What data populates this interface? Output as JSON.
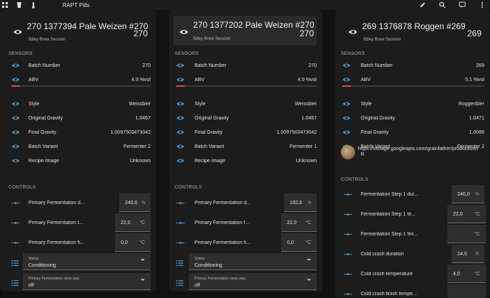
{
  "topbar": {
    "title": "RAPT Pills",
    "icons": [
      "dashboard-icon",
      "cup-icon",
      "thermometer-icon",
      "pencil-icon",
      "search-icon",
      "chat-icon",
      "more-vert-icon"
    ]
  },
  "colors": {
    "card": "#1c1c1c",
    "background": "#111111",
    "accent": "#4a8ec2",
    "abv_bar": "#d05050"
  },
  "cards": [
    {
      "title": "270 1377394 Pale Weizen #270",
      "subtitle": "fidley Brew Session",
      "number": "270",
      "sensors_label": "SENSORS",
      "sensors": [
        {
          "label": "Batch Number",
          "value": "270"
        },
        {
          "label": "ABV",
          "value": "4.9 %vol"
        },
        {
          "label": "Style",
          "value": "Weissbier"
        },
        {
          "label": "Original Gravity",
          "value": "1.0467"
        },
        {
          "label": "Final Gravity",
          "value": "1.0097503473042"
        },
        {
          "label": "Batch Variant",
          "value": "Fermenter 2"
        },
        {
          "label": "Recipe Image",
          "value": "Unknown"
        }
      ],
      "controls_label": "CONTROLS",
      "controls": [
        {
          "label": "Primary Fermentation d...",
          "value": "240,0",
          "unit": "h"
        },
        {
          "label": "Primary Fermentation t...",
          "value": "22,0",
          "unit": "°C"
        },
        {
          "label": "Primary Fermentation fi...",
          "value": "0,0",
          "unit": "°C"
        }
      ],
      "selects": [
        {
          "label": "Status",
          "value": "Conditioning"
        },
        {
          "label": "Primary Fermentation ramp step",
          "value": "off"
        }
      ]
    },
    {
      "title": "270 1377202 Pale Weizen #270",
      "subtitle": "fidley Brew Session",
      "number": "270",
      "sensors_label": "SENSORS",
      "sensors": [
        {
          "label": "Batch Number",
          "value": "270"
        },
        {
          "label": "ABV",
          "value": "4.9 %vol"
        },
        {
          "label": "Style",
          "value": "Weissbier"
        },
        {
          "label": "Original Gravity",
          "value": "1.0467"
        },
        {
          "label": "Final Gravity",
          "value": "1.0097503473042"
        },
        {
          "label": "Batch Variant",
          "value": "Fermenter 1"
        },
        {
          "label": "Recipe Image",
          "value": "Unknown"
        }
      ],
      "controls_label": "CONTROLS",
      "controls": [
        {
          "label": "Primary Fermentation d...",
          "value": "192,0",
          "unit": "h"
        },
        {
          "label": "Primary Fermentation t...",
          "value": "22,0",
          "unit": "°C"
        },
        {
          "label": "Primary Fermentation fi...",
          "value": "0,0",
          "unit": "°C"
        }
      ],
      "selects": [
        {
          "label": "Status",
          "value": "Conditioning"
        },
        {
          "label": "Primary Fermentation ramp step",
          "value": "off"
        }
      ]
    },
    {
      "title": "269 1376878 Roggen #269",
      "subtitle": "fidley Brew Session",
      "number": "269",
      "sensors_label": "SENSORS",
      "sensors": [
        {
          "label": "Batch Number",
          "value": "269"
        },
        {
          "label": "ABV",
          "value": "5.1 %vol"
        },
        {
          "label": "Style",
          "value": "Roggenbier"
        },
        {
          "label": "Original Gravity",
          "value": "1.0471"
        },
        {
          "label": "Final Gravity",
          "value": "1.0086"
        },
        {
          "label": "Batch Variant",
          "value": "Fermenter 2"
        }
      ],
      "image_url": "https://storage.googleapis.com/grainfather/production/r",
      "image_url_suffix": "R",
      "controls_label": "CONTROLS",
      "controls": [
        {
          "label": "Fermentation Step 1 dur...",
          "value": "240,0",
          "unit": "h"
        },
        {
          "label": "Fermentation Step 1 te...",
          "value": "22,0",
          "unit": "°C"
        },
        {
          "label": "Fermentation Step 1 fini...",
          "value": "",
          "unit": "°C"
        },
        {
          "label": "Cold crash duration",
          "value": "24,0",
          "unit": "h"
        },
        {
          "label": "Cold crash temperature",
          "value": "4,0",
          "unit": "°C"
        },
        {
          "label": "Cold crash finish tempe...",
          "value": "",
          "unit": ""
        }
      ]
    }
  ]
}
